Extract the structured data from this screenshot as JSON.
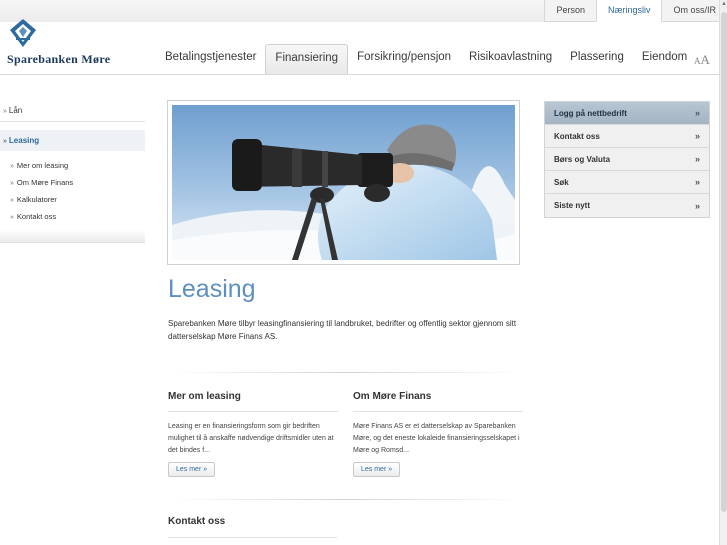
{
  "top_links": [
    "Person",
    "Næringsliv",
    "Om oss/IR"
  ],
  "brand": {
    "name": "Sparebanken Møre"
  },
  "nav": [
    "Betalingstjenester",
    "Finansiering",
    "Forsikring/pensjon",
    "Risikoavlastning",
    "Plassering",
    "Eiendom"
  ],
  "font_size_control": {
    "small": "A",
    "big": "A"
  },
  "sidebar": {
    "arrow": "»",
    "items": [
      "Lån",
      "Leasing"
    ],
    "sub_items": [
      "Mer om leasing",
      "Om Møre Finans",
      "Kalkulatorer",
      "Kontakt oss"
    ]
  },
  "main": {
    "title": "Leasing",
    "intro": "Sparebanken Møre tilbyr leasingfinansiering til landbruket, bedrifter og offentlig sektor gjennom sitt datterselskap Møre Finans AS.",
    "columns": [
      {
        "heading": "Mer om leasing",
        "text": "Leasing er en finansieringsform som gir bedriften mulighet til å anskaffe nødvendige driftsmidler uten at det bindes f...",
        "button": "Les mer »"
      },
      {
        "heading": "Om Møre Finans",
        "text": "Møre Finans AS er et datterselskap av Sparebanken Møre, og det eneste lokaleide finansieringsselskapet i Møre og Romsd...",
        "button": "Les mer »"
      }
    ],
    "contact_title": "Kontakt oss"
  },
  "right_panel": {
    "chevron": "»",
    "items": [
      "Logg på nettbedrift",
      "Kontakt oss",
      "Børs og Valuta",
      "Søk",
      "Siste nytt"
    ]
  },
  "colors": {
    "brand_blue": "#2d6a9f",
    "title_blue": "#5d8fbf",
    "logo_navy": "#1b3a5c",
    "panel_highlight": "#b8c6d3"
  }
}
